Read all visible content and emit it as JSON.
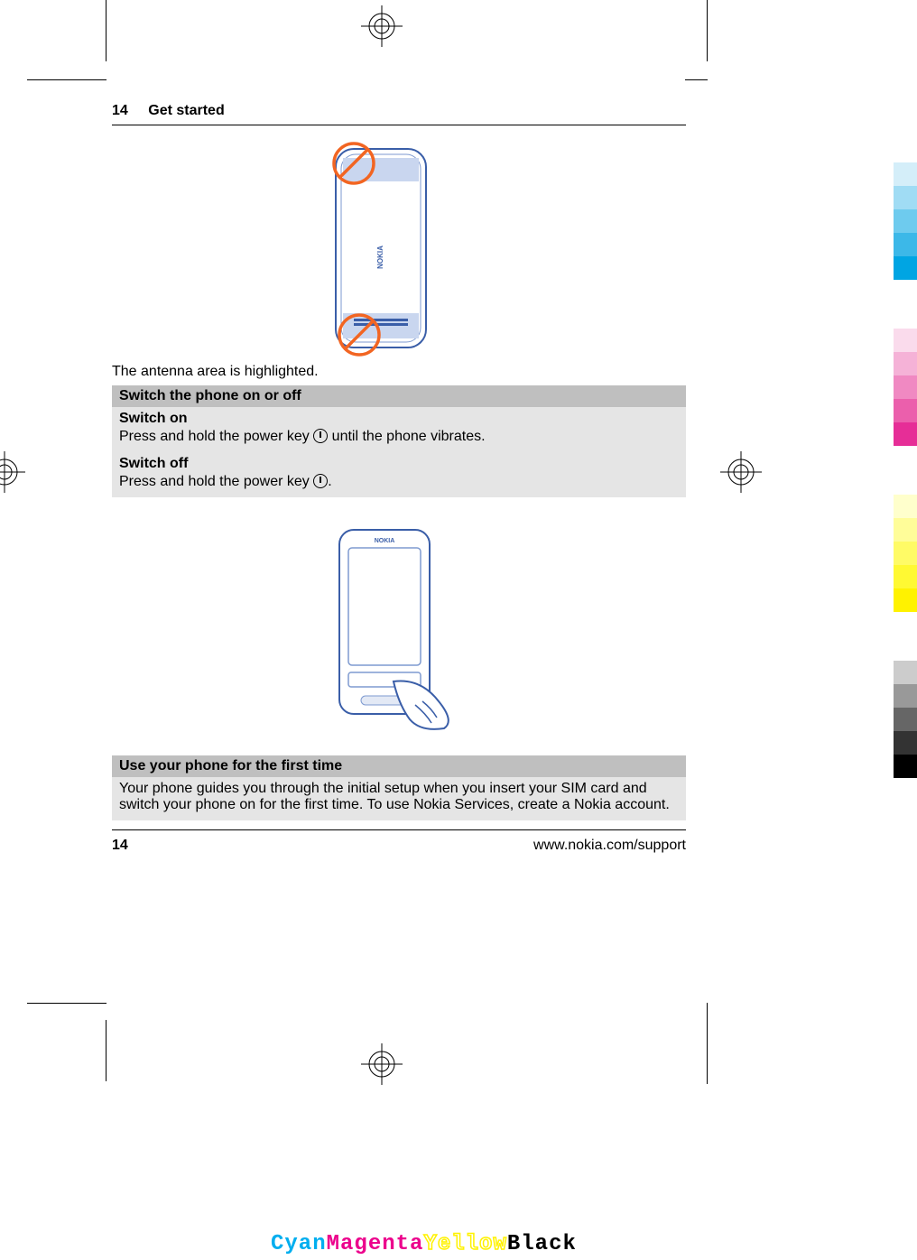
{
  "header": {
    "page": "14",
    "title": "Get started"
  },
  "antenna_caption": "The antenna area is highlighted.",
  "sections": {
    "switch_title": "Switch the phone on or off",
    "switch_on": {
      "title": "Switch on",
      "text_before": "Press and hold the power key ",
      "text_after": " until the phone vibrates."
    },
    "switch_off": {
      "title": "Switch off",
      "text_before": "Press and hold the power key ",
      "text_after": "."
    },
    "first_time_title": "Use your phone for the first time",
    "first_time_body": "Your phone guides you through the initial setup when you insert your SIM card and switch your phone on for the first time. To use Nokia Services, create a Nokia account."
  },
  "footer": {
    "page": "14",
    "url": "www.nokia.com/support"
  },
  "cmyk": {
    "c": "Cyan",
    "m": "Magenta",
    "y": "Yellow",
    "k": "Black"
  },
  "colorbars": [
    "#d4eef9",
    "#a0dcf4",
    "#6ecbee",
    "#3cb8e8",
    "#00a5e3",
    "#fadbec",
    "#f5b2d7",
    "#f089c2",
    "#eb5fac",
    "#e62e97",
    "#ffffcc",
    "#fffd99",
    "#fffb66",
    "#fff933",
    "#fff200",
    "#cccccc",
    "#999999",
    "#666666",
    "#333333",
    "#000000"
  ]
}
